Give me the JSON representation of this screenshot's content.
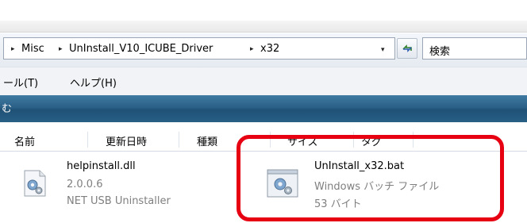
{
  "address_bar": {
    "crumbs": [
      "Misc",
      "UnInstall_V10_ICUBE_Driver",
      "x32"
    ],
    "separator": "▸",
    "dropdown": "▾"
  },
  "search": {
    "placeholder": "検索"
  },
  "menu": {
    "items": [
      "ール(T)",
      "ヘルプ(H)"
    ]
  },
  "toolbar": {
    "label": "む"
  },
  "columns": [
    "名前",
    "更新日時",
    "種類",
    "サイズ",
    "タグ"
  ],
  "files": [
    {
      "name": "helpinstall.dll",
      "line2": "2.0.0.6",
      "line3": "NET USB Uninstaller",
      "icon": "gear-file-icon"
    },
    {
      "name": "UnInstall_x32.bat",
      "line2": "Windows バッチ ファイル",
      "line3": "53 バイト",
      "icon": "batch-file-icon"
    }
  ],
  "colors": {
    "toolbar": "#2b6087",
    "highlight": "#e60012",
    "meta_text": "#7f7f7f"
  }
}
